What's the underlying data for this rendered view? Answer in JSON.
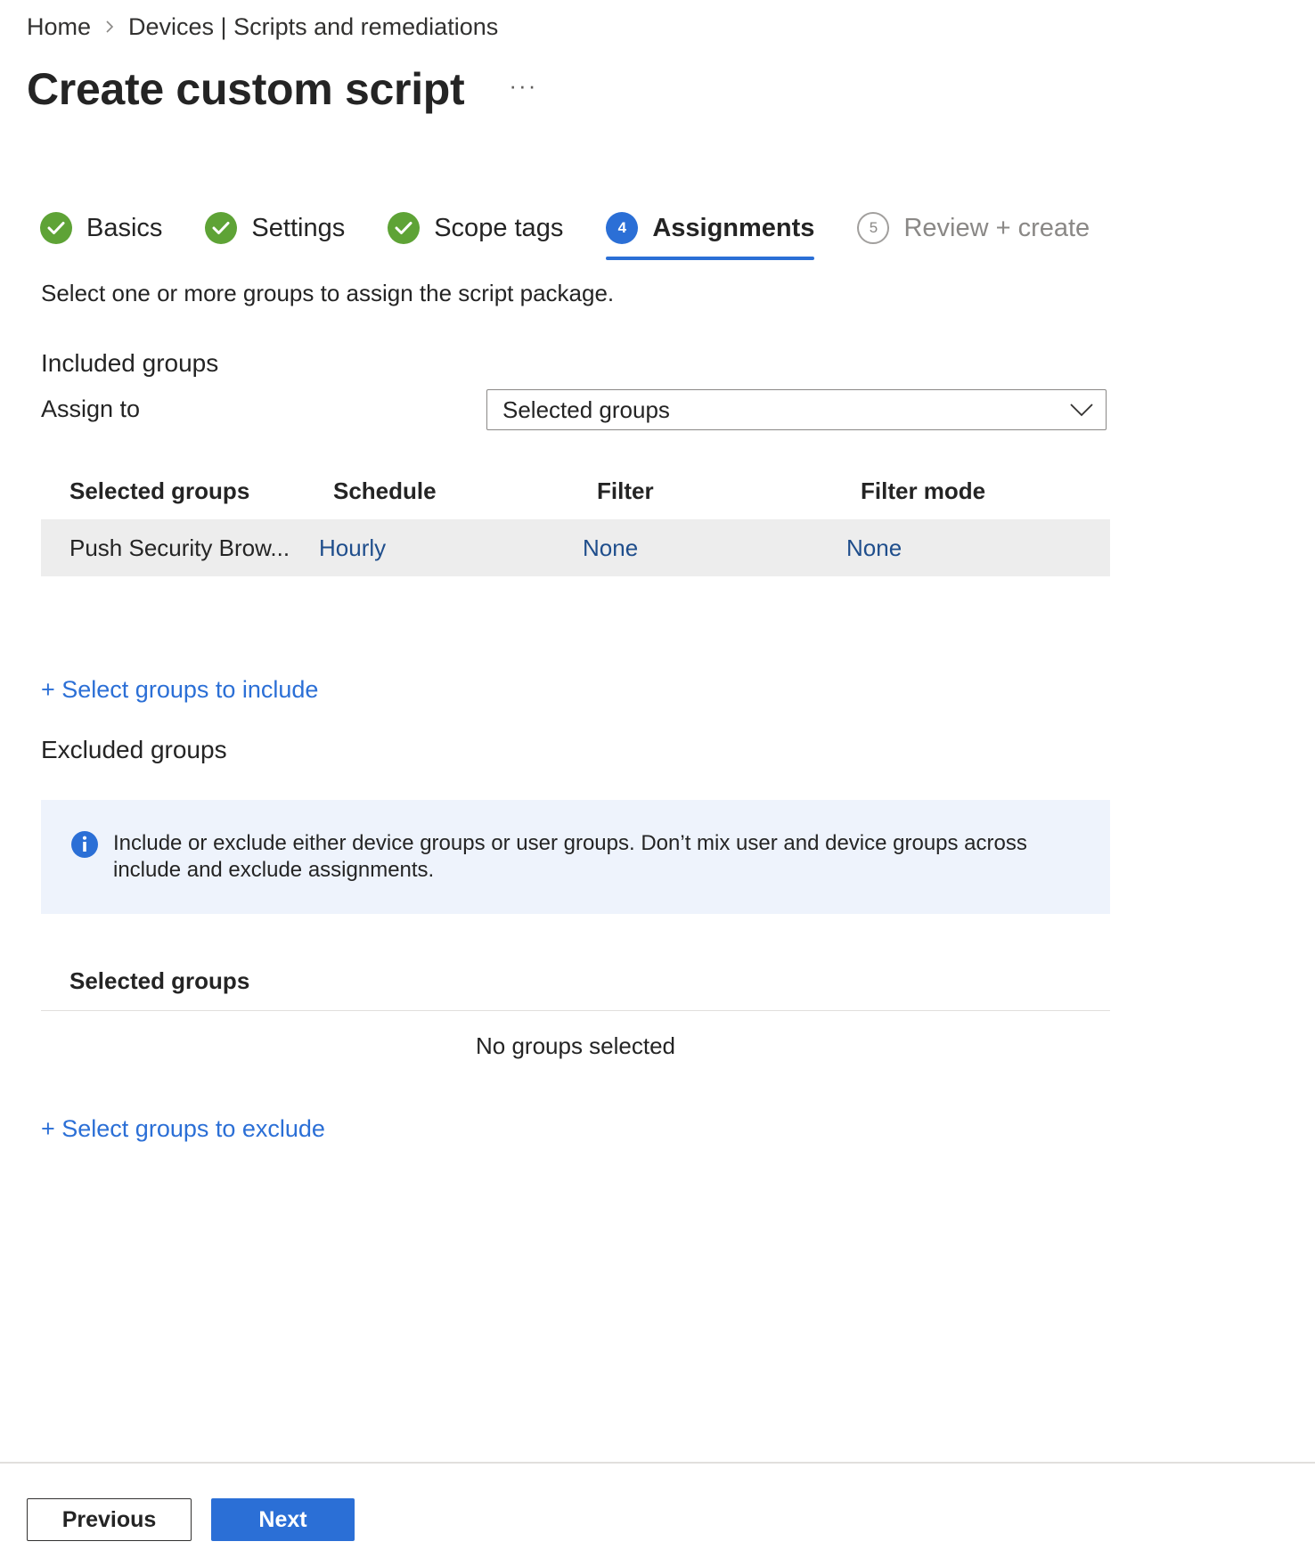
{
  "breadcrumb": {
    "home": "Home",
    "current": "Devices | Scripts and remediations"
  },
  "header": {
    "title": "Create custom script",
    "more": "···"
  },
  "wizard": {
    "steps": [
      {
        "label": "Basics",
        "state": "done"
      },
      {
        "label": "Settings",
        "state": "done"
      },
      {
        "label": "Scope tags",
        "state": "done"
      },
      {
        "label": "Assignments",
        "number": "4",
        "state": "current"
      },
      {
        "label": "Review + create",
        "number": "5",
        "state": "future"
      }
    ]
  },
  "assignments": {
    "description": "Select one or more groups to assign the script package.",
    "included": {
      "heading": "Included groups",
      "assign_to_label": "Assign to",
      "assign_to_value": "Selected groups",
      "columns": [
        "Selected groups",
        "Schedule",
        "Filter",
        "Filter mode"
      ],
      "rows": [
        {
          "group": "Push Security Brow...",
          "schedule": "Hourly",
          "filter": "None",
          "filter_mode": "None"
        }
      ],
      "add_link": "+ Select groups to include"
    },
    "excluded": {
      "heading": "Excluded groups",
      "info": "Include or exclude either device groups or user groups. Don’t mix user and device groups across include and exclude assignments.",
      "column": "Selected groups",
      "empty": "No groups selected",
      "add_link": "+ Select groups to exclude"
    }
  },
  "footer": {
    "previous": "Previous",
    "next": "Next"
  },
  "colors": {
    "accent": "#2b6fd6",
    "done": "#5ea336",
    "info_bg": "#eef3fc"
  }
}
